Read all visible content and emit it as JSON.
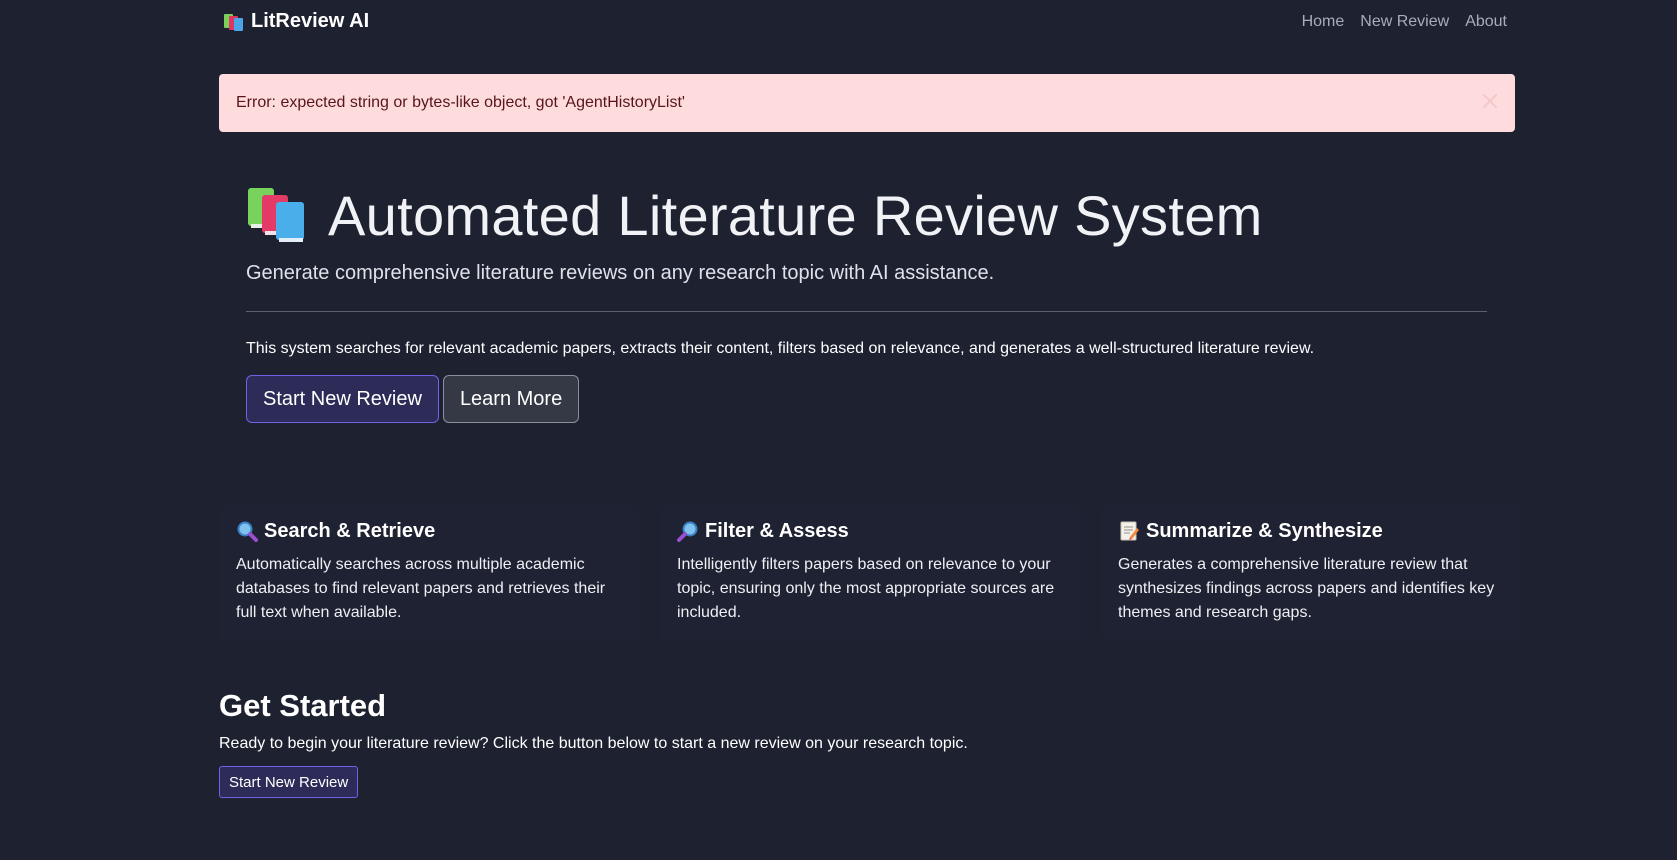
{
  "navbar": {
    "brand": "LitReview AI",
    "links": [
      "Home",
      "New Review",
      "About"
    ]
  },
  "alert": {
    "message": "Error: expected string or bytes-like object, got 'AgentHistoryList'"
  },
  "hero": {
    "title": "Automated Literature Review System",
    "lead": "Generate comprehensive literature reviews on any research topic with AI assistance.",
    "description": "This system searches for relevant academic papers, extracts their content, filters based on relevance, and generates a well-structured literature review.",
    "primary_button": "Start New Review",
    "secondary_button": "Learn More"
  },
  "features": [
    {
      "icon": "magnifying-glass-left-icon",
      "title": "Search & Retrieve",
      "text": "Automatically searches across multiple academic databases to find relevant papers and retrieves their full text when available."
    },
    {
      "icon": "magnifying-glass-right-icon",
      "title": "Filter & Assess",
      "text": "Intelligently filters papers based on relevance to your topic, ensuring only the most appropriate sources are included."
    },
    {
      "icon": "memo-icon",
      "title": "Summarize & Synthesize",
      "text": "Generates a comprehensive literature review that synthesizes findings across papers and identifies key themes and research gaps."
    }
  ],
  "get_started": {
    "title": "Get Started",
    "text": "Ready to begin your literature review? Click the button below to start a new review on your research topic.",
    "button": "Start New Review"
  },
  "colors": {
    "background": "#1d2130",
    "alert_background": "#fedcdd",
    "primary_border": "#6c63e8",
    "primary_fill": "#2d2c58"
  }
}
